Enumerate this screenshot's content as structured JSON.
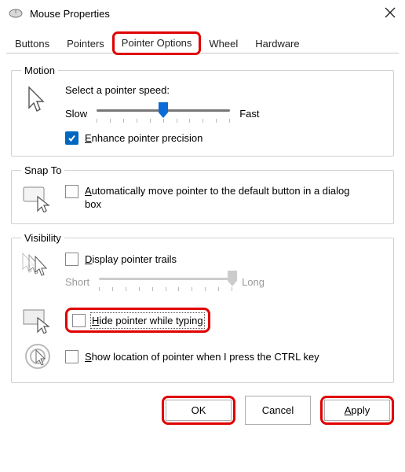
{
  "window": {
    "title": "Mouse Properties",
    "close_label": "Close"
  },
  "tabs": {
    "items": [
      {
        "label": "Buttons"
      },
      {
        "label": "Pointers"
      },
      {
        "label": "Pointer Options"
      },
      {
        "label": "Wheel"
      },
      {
        "label": "Hardware"
      }
    ],
    "active_index": 2,
    "highlighted_index": 2
  },
  "motion": {
    "legend": "Motion",
    "select_label": "Select a pointer speed:",
    "slow_label": "Slow",
    "fast_label": "Fast",
    "slider_value": 5,
    "slider_ticks": 11,
    "enhance_checked": true,
    "enhance_key": "E",
    "enhance_rest": "nhance pointer precision"
  },
  "snap": {
    "legend": "Snap To",
    "auto_checked": false,
    "auto_key": "A",
    "auto_rest": "utomatically move pointer to the default button in a dialog box"
  },
  "visibility": {
    "legend": "Visibility",
    "trails_checked": false,
    "trails_key": "D",
    "trails_rest": "isplay pointer trails",
    "trail_short": "Short",
    "trail_long": "Long",
    "trail_value": 10,
    "trail_ticks": 11,
    "hide_checked": false,
    "hide_pre": "",
    "hide_key": "H",
    "hide_rest": "ide pointer while typing",
    "ctrl_checked": false,
    "ctrl_key": "S",
    "ctrl_rest": "how location of pointer when I press the CTRL key"
  },
  "buttons": {
    "ok": "OK",
    "cancel": "Cancel",
    "apply_key": "A",
    "apply_rest": "pply"
  }
}
